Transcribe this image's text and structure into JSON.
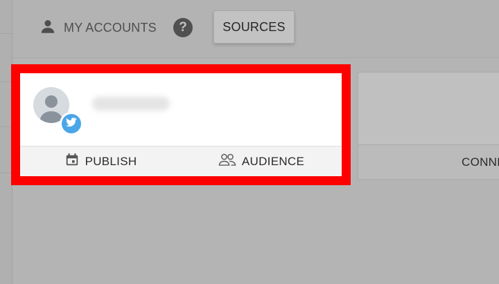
{
  "header": {
    "accounts_label": "MY ACCOUNTS",
    "help_glyph": "?",
    "sources_label": "SOURCES"
  },
  "profile_card": {
    "network": "twitter",
    "highlight_color": "#ff0000",
    "publish_label": "PUBLISH",
    "audience_label": "AUDIENCE"
  },
  "second_card": {
    "connect_label": "CONNE"
  },
  "colors": {
    "twitter_blue": "#4aa6e8"
  }
}
